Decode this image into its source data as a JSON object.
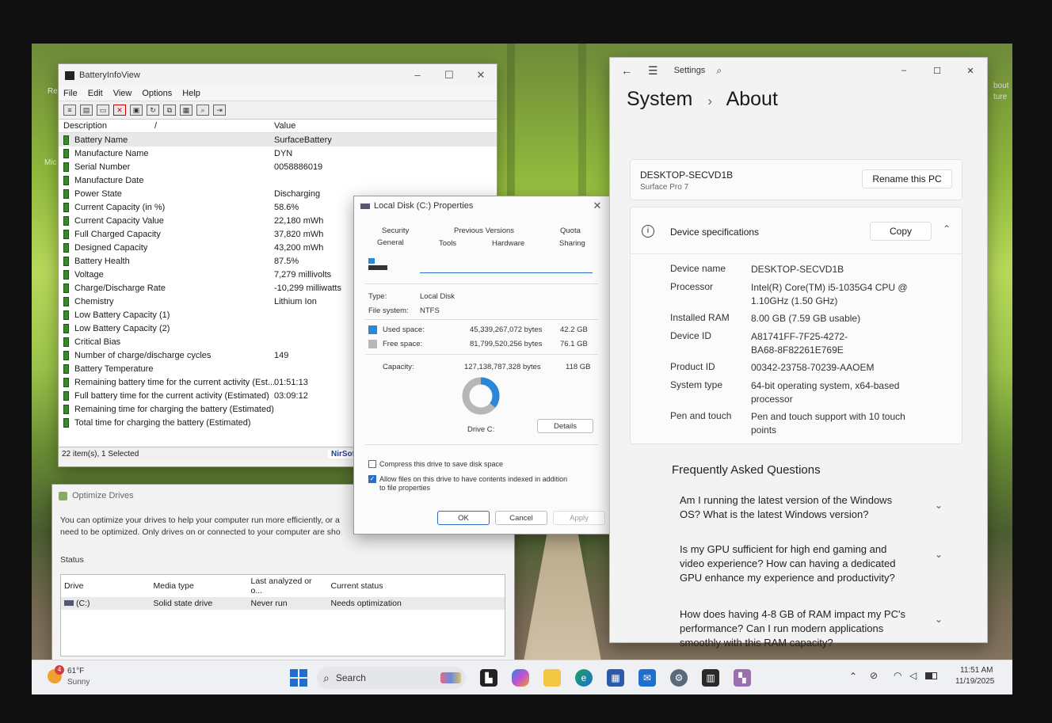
{
  "battery_app": {
    "title": "BatteryInfoView",
    "menu": [
      "File",
      "Edit",
      "View",
      "Options",
      "Help"
    ],
    "col_description": "Description",
    "col_sort": "/",
    "col_value": "Value",
    "rows": [
      {
        "d": "Battery Name",
        "v": "SurfaceBattery"
      },
      {
        "d": "Manufacture Name",
        "v": "DYN"
      },
      {
        "d": "Serial Number",
        "v": "0058886019"
      },
      {
        "d": "Manufacture Date",
        "v": ""
      },
      {
        "d": "Power State",
        "v": "Discharging"
      },
      {
        "d": "Current Capacity (in %)",
        "v": "58.6%"
      },
      {
        "d": "Current Capacity Value",
        "v": "22,180 mWh"
      },
      {
        "d": "Full Charged Capacity",
        "v": "37,820 mWh"
      },
      {
        "d": "Designed Capacity",
        "v": "43,200 mWh"
      },
      {
        "d": "Battery Health",
        "v": "87.5%"
      },
      {
        "d": "Voltage",
        "v": "7,279 millivolts"
      },
      {
        "d": "Charge/Discharge Rate",
        "v": "-10,299 milliwatts"
      },
      {
        "d": "Chemistry",
        "v": "Lithium Ion"
      },
      {
        "d": "Low Battery Capacity (1)",
        "v": ""
      },
      {
        "d": "Low Battery Capacity (2)",
        "v": ""
      },
      {
        "d": "Critical Bias",
        "v": ""
      },
      {
        "d": "Number of charge/discharge cycles",
        "v": "149"
      },
      {
        "d": "Battery Temperature",
        "v": ""
      },
      {
        "d": "Remaining battery time for the current activity (Est...",
        "v": "01:51:13"
      },
      {
        "d": "Full battery time for the current activity (Estimated)",
        "v": "03:09:12"
      },
      {
        "d": "Remaining time for charging the battery (Estimated)",
        "v": ""
      },
      {
        "d": "Total time for charging the battery (Estimated)",
        "v": ""
      }
    ],
    "status_count": "22 item(s), 1 Selected",
    "status_link": "NirSoft Freeware. ht"
  },
  "optimize": {
    "title": "Optimize Drives",
    "desc_1": "You can optimize your drives to help your computer run more efficiently, or a",
    "desc_2": "need to be optimized. Only drives on or connected to your computer are sho",
    "status_label": "Status",
    "headers": [
      "Drive",
      "Media type",
      "Last analyzed or o...",
      "Current status"
    ],
    "row": [
      "(C:)",
      "Solid state drive",
      "Never run",
      "Needs optimization"
    ]
  },
  "properties": {
    "title": "Local Disk (C:) Properties",
    "tabs": {
      "security": "Security",
      "previous": "Previous Versions",
      "quota": "Quota",
      "general": "General",
      "tools": "Tools",
      "hardware": "Hardware",
      "sharing": "Sharing"
    },
    "type_label": "Type:",
    "type_value": "Local Disk",
    "fs_label": "File system:",
    "fs_value": "NTFS",
    "used_label": "Used space:",
    "used_bytes": "45,339,267,072 bytes",
    "used_gb": "42.2 GB",
    "free_label": "Free space:",
    "free_bytes": "81,799,520,256 bytes",
    "free_gb": "76.1 GB",
    "cap_label": "Capacity:",
    "cap_bytes": "127,138,787,328 bytes",
    "cap_gb": "118 GB",
    "used_fraction": 0.357,
    "drive_label": "Drive C:",
    "details": "Details",
    "compress": "Compress this drive to save disk space",
    "index_1": "Allow files on this drive to have contents indexed in addition",
    "index_2": "to file properties",
    "ok": "OK",
    "cancel": "Cancel",
    "apply": "Apply",
    "colors": {
      "used": "#2b88d8",
      "free": "#b7b7b7"
    }
  },
  "settings": {
    "app": "Settings",
    "crumb_1": "System",
    "crumb_sep": "›",
    "crumb_2": "About",
    "pc_name": "DESKTOP-SECVD1B",
    "model": "Surface Pro 7",
    "rename": "Rename this PC",
    "spec_header": "Device specifications",
    "copy": "Copy",
    "specs": [
      {
        "k": "Device name",
        "v1": "DESKTOP-SECVD1B",
        "v2": ""
      },
      {
        "k": "Processor",
        "v1": "Intel(R) Core(TM) i5-1035G4 CPU @",
        "v2": "1.10GHz (1.50 GHz)"
      },
      {
        "k": "Installed RAM",
        "v1": "8.00 GB (7.59 GB usable)",
        "v2": ""
      },
      {
        "k": "Device ID",
        "v1": "A81741FF-7F25-4272-",
        "v2": "BA68-8F82261E769E"
      },
      {
        "k": "Product ID",
        "v1": "00342-23758-70239-AAOEM",
        "v2": ""
      },
      {
        "k": "System type",
        "v1": "64-bit operating system, x64-based",
        "v2": "processor"
      },
      {
        "k": "Pen and touch",
        "v1": "Pen and touch support with 10 touch",
        "v2": "points"
      }
    ],
    "faq_title": "Frequently Asked Questions",
    "faqs": [
      {
        "l1": "Am I running the latest version of the Windows",
        "l2": "OS? What is the latest Windows version?",
        "l3": ""
      },
      {
        "l1": "Is my GPU sufficient for high end gaming and",
        "l2": "video experience? How can having a dedicated",
        "l3": "GPU enhance my experience and productivity?"
      },
      {
        "l1": "How does having 4-8 GB of RAM impact my PC's",
        "l2": "performance? Can I run modern applications",
        "l3": "smoothly with this RAM capacity?"
      }
    ]
  },
  "desktop": {
    "rec": "Rec",
    "mic": "Mic",
    "about": "bout",
    "ture": "ture"
  },
  "taskbar": {
    "weather_badge": "4",
    "temp": "61°F",
    "condition": "Sunny",
    "search": "Search",
    "time": "11:51 AM",
    "date": "11/19/2025"
  }
}
